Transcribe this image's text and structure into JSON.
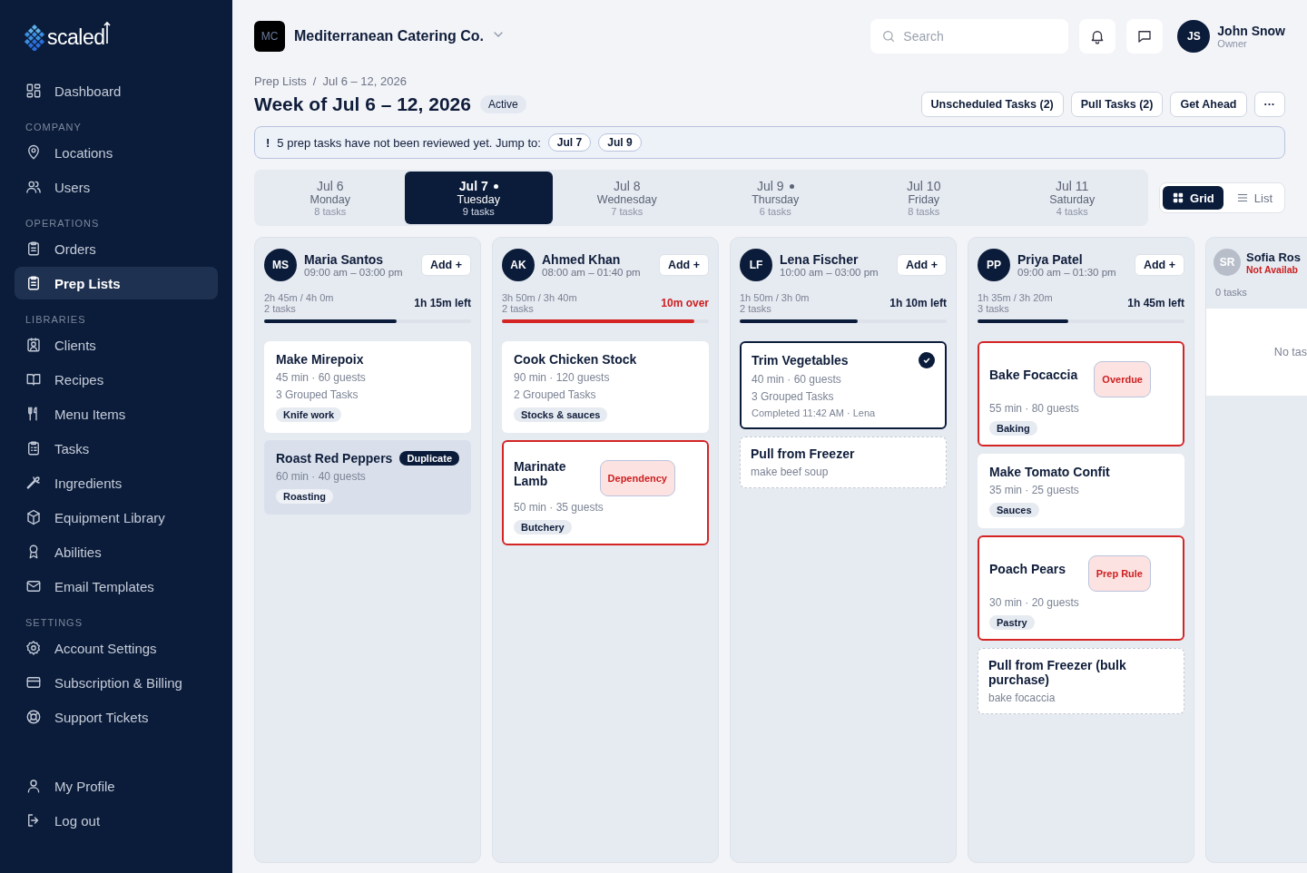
{
  "sidebar": {
    "brand": "scaled",
    "top_items": [
      {
        "label": "Dashboard",
        "selected": false
      }
    ],
    "sections": [
      {
        "title": "COMPANY",
        "items": [
          {
            "label": "Locations",
            "selected": false
          },
          {
            "label": "Users",
            "selected": false
          }
        ]
      },
      {
        "title": "OPERATIONS",
        "items": [
          {
            "label": "Orders",
            "selected": false
          },
          {
            "label": "Prep Lists",
            "selected": true
          }
        ]
      },
      {
        "title": "LIBRARIES",
        "items": [
          {
            "label": "Clients",
            "selected": false
          },
          {
            "label": "Recipes",
            "selected": false
          },
          {
            "label": "Menu Items",
            "selected": false
          },
          {
            "label": "Tasks",
            "selected": false
          },
          {
            "label": "Ingredients",
            "selected": false
          },
          {
            "label": "Equipment Library",
            "selected": false
          },
          {
            "label": "Abilities",
            "selected": false
          },
          {
            "label": "Email Templates",
            "selected": false
          }
        ]
      },
      {
        "title": "SETTINGS",
        "items": [
          {
            "label": "Account Settings",
            "selected": false
          },
          {
            "label": "Subscription & Billing",
            "selected": false
          },
          {
            "label": "Support Tickets",
            "selected": false
          }
        ]
      }
    ],
    "bottom_items": [
      {
        "label": "My Profile",
        "selected": false
      },
      {
        "label": "Log out",
        "selected": false
      }
    ]
  },
  "topbar": {
    "company": {
      "initials": "MC",
      "name": "Mediterranean Catering Co."
    },
    "search": {
      "placeholder": "Search"
    },
    "user": {
      "initials": "JS",
      "name": "John Snow",
      "role": "Owner"
    }
  },
  "breadcrumb": [
    "Prep Lists",
    "Jul 6 – 12, 2026"
  ],
  "breadcrumb_separator": "/",
  "title": "Week of Jul 6 – 12, 2026",
  "status": "Active",
  "actions": [
    "Unscheduled Tasks (2)",
    "Pull Tasks (2)",
    "Get Ahead",
    "···"
  ],
  "alert": {
    "mark": "!",
    "text": "5 prep tasks have not been reviewed yet. Jump to:",
    "jumps": [
      "Jul 7",
      "Jul 9"
    ]
  },
  "days": [
    {
      "date": "Jul 6",
      "weekday": "Monday",
      "count": "8 tasks",
      "selected": false,
      "flagged": false
    },
    {
      "date": "Jul 7",
      "weekday": "Tuesday",
      "count": "9 tasks",
      "selected": true,
      "flagged": true
    },
    {
      "date": "Jul 8",
      "weekday": "Wednesday",
      "count": "7 tasks",
      "selected": false,
      "flagged": false
    },
    {
      "date": "Jul 9",
      "weekday": "Thursday",
      "count": "6 tasks",
      "selected": false,
      "flagged": true
    },
    {
      "date": "Jul 10",
      "weekday": "Friday",
      "count": "8 tasks",
      "selected": false,
      "flagged": false
    },
    {
      "date": "Jul 11",
      "weekday": "Saturday",
      "count": "4 tasks",
      "selected": false,
      "flagged": false
    }
  ],
  "views": [
    {
      "label": "Grid",
      "selected": true
    },
    {
      "label": "List",
      "selected": false
    }
  ],
  "columns": [
    {
      "kind": "available",
      "initials": "MS",
      "name": "Maria Santos",
      "shift": "09:00 am – 03:00 pm",
      "add": "Add +",
      "hours": "2h 45m / 4h 0m",
      "count": "2 tasks",
      "remaining": "1h 15m left",
      "over": false,
      "level": 0.64,
      "tasks": [
        {
          "kind": "normal",
          "title": "Make Mirepoix",
          "meta": "45 min · 60 guests",
          "grouped": "3 Grouped Tasks",
          "tag": "Knife work"
        },
        {
          "kind": "duplicate",
          "title": "Roast Red Peppers",
          "badge": "Duplicate",
          "meta": "60 min · 40 guests",
          "tag": "Roasting"
        }
      ]
    },
    {
      "kind": "available",
      "initials": "AK",
      "name": "Ahmed Khan",
      "shift": "08:00 am – 01:40 pm",
      "add": "Add +",
      "hours": "3h 50m / 3h 40m",
      "count": "2 tasks",
      "remaining": "10m over",
      "over": true,
      "level": 0.93,
      "tasks": [
        {
          "kind": "normal",
          "title": "Cook Chicken Stock",
          "meta": "90 min · 120 guests",
          "grouped": "2 Grouped Tasks",
          "tag": "Stocks & sauces"
        },
        {
          "kind": "alert",
          "title": "Marinate Lamb",
          "badge": "Dependency",
          "meta": "50 min · 35 guests",
          "tag": "Butchery"
        }
      ]
    },
    {
      "kind": "available",
      "initials": "LF",
      "name": "Lena Fischer",
      "shift": "10:00 am – 03:00 pm",
      "add": "Add +",
      "hours": "1h 50m / 3h 0m",
      "count": "2 tasks",
      "remaining": "1h 10m left",
      "over": false,
      "level": 0.57,
      "tasks": [
        {
          "kind": "completed",
          "title": "Trim Vegetables",
          "meta": "40 min · 60 guests",
          "grouped": "3 Grouped Tasks",
          "note": "Completed 11:42 AM · Lena"
        },
        {
          "kind": "pull",
          "title": "Pull from Freezer",
          "meta": "make beef soup"
        }
      ]
    },
    {
      "kind": "available",
      "initials": "PP",
      "name": "Priya Patel",
      "shift": "09:00 am – 01:30 pm",
      "add": "Add +",
      "hours": "1h 35m / 3h 20m",
      "count": "3 tasks",
      "remaining": "1h 45m left",
      "over": false,
      "level": 0.44,
      "tasks": [
        {
          "kind": "alert",
          "title": "Bake Focaccia",
          "badge": "Overdue",
          "meta": "55 min · 80 guests",
          "tag": "Baking"
        },
        {
          "kind": "normal",
          "title": "Make Tomato Confit",
          "meta": "35 min · 25 guests",
          "tag": "Sauces"
        },
        {
          "kind": "alert",
          "title": "Poach Pears",
          "badge": "Prep Rule",
          "meta": "30 min · 20 guests",
          "tag": "Pastry"
        },
        {
          "kind": "pull",
          "title": "Pull from Freezer (bulk purchase)",
          "meta": "bake focaccia"
        }
      ]
    },
    {
      "kind": "unavailable",
      "initials": "SR",
      "name": "Sofia Ros",
      "availability": "Not Availab",
      "count": "0 tasks",
      "empty": "No tas"
    }
  ]
}
